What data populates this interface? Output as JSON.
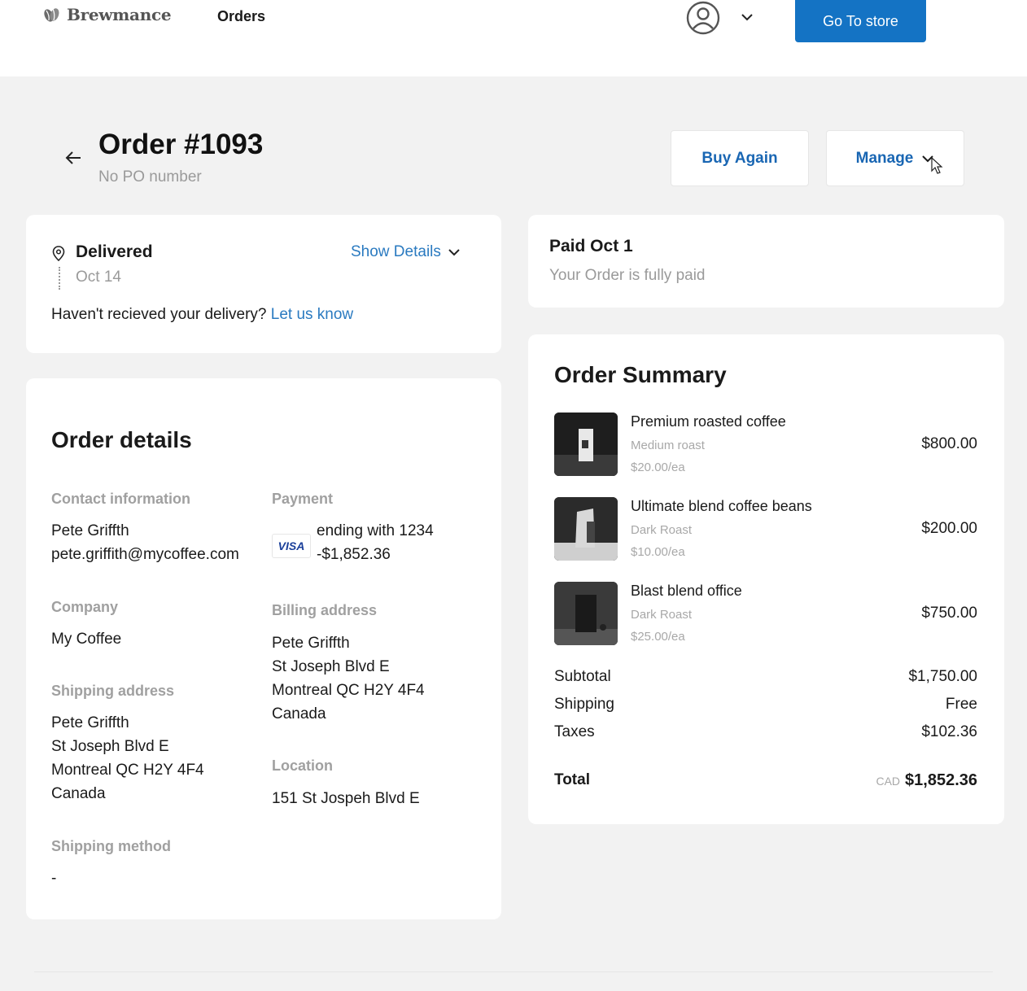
{
  "header": {
    "brand": "Brewmance",
    "nav_orders": "Orders",
    "go_to_store": "Go To store"
  },
  "order": {
    "title": "Order #1093",
    "po": "No PO number",
    "buy_again": "Buy Again",
    "manage": "Manage"
  },
  "delivery": {
    "status": "Delivered",
    "date": "Oct 14",
    "show_details": "Show Details",
    "question": "Haven't recieved your delivery?",
    "let_us_know": "Let us know"
  },
  "payment_status": {
    "title": "Paid Oct 1",
    "subtitle": "Your Order is fully paid"
  },
  "details": {
    "heading": "Order details",
    "contact_label": "Contact information",
    "contact_name": "Pete Griffth",
    "contact_email": "pete.griffith@mycoffee.com",
    "payment_label": "Payment",
    "card_brand": "VISA",
    "card_ending": "ending with 1234",
    "card_amount": "-$1,852.36",
    "company_label": "Company",
    "company": "My Coffee",
    "billing_label": "Billing address",
    "billing": [
      "Pete Griffth",
      "St Joseph Blvd E",
      "Montreal QC H2Y 4F4",
      "Canada"
    ],
    "shipping_label": "Shipping address",
    "shipping": [
      "Pete Griffth",
      "St Joseph Blvd E",
      "Montreal QC H2Y 4F4",
      "Canada"
    ],
    "location_label": "Location",
    "location": "151 St Jospeh Blvd E",
    "shipping_method_label": "Shipping method",
    "shipping_method": "-"
  },
  "summary": {
    "heading": "Order Summary",
    "items": [
      {
        "name": "Premium roasted coffee",
        "variant": "Medium roast",
        "unit": "$20.00/ea",
        "price": "$800.00"
      },
      {
        "name": "Ultimate blend coffee beans",
        "variant": "Dark Roast",
        "unit": "$10.00/ea",
        "price": "$200.00"
      },
      {
        "name": "Blast blend office",
        "variant": "Dark Roast",
        "unit": "$25.00/ea",
        "price": "$750.00"
      }
    ],
    "subtotal_label": "Subtotal",
    "subtotal": "$1,750.00",
    "shipping_label": "Shipping",
    "shipping": "Free",
    "taxes_label": "Taxes",
    "taxes": "$102.36",
    "total_label": "Total",
    "currency": "CAD",
    "total": "$1,852.36"
  },
  "colors": {
    "accent": "#1473c4",
    "link": "#2a7ac0",
    "page_bg": "#f2f2f2"
  },
  "icons": [
    "coffee-bean-logo-icon",
    "user-avatar-icon",
    "chevron-down-icon",
    "back-arrow-icon",
    "location-pin-icon",
    "visa-icon",
    "cursor-icon"
  ]
}
